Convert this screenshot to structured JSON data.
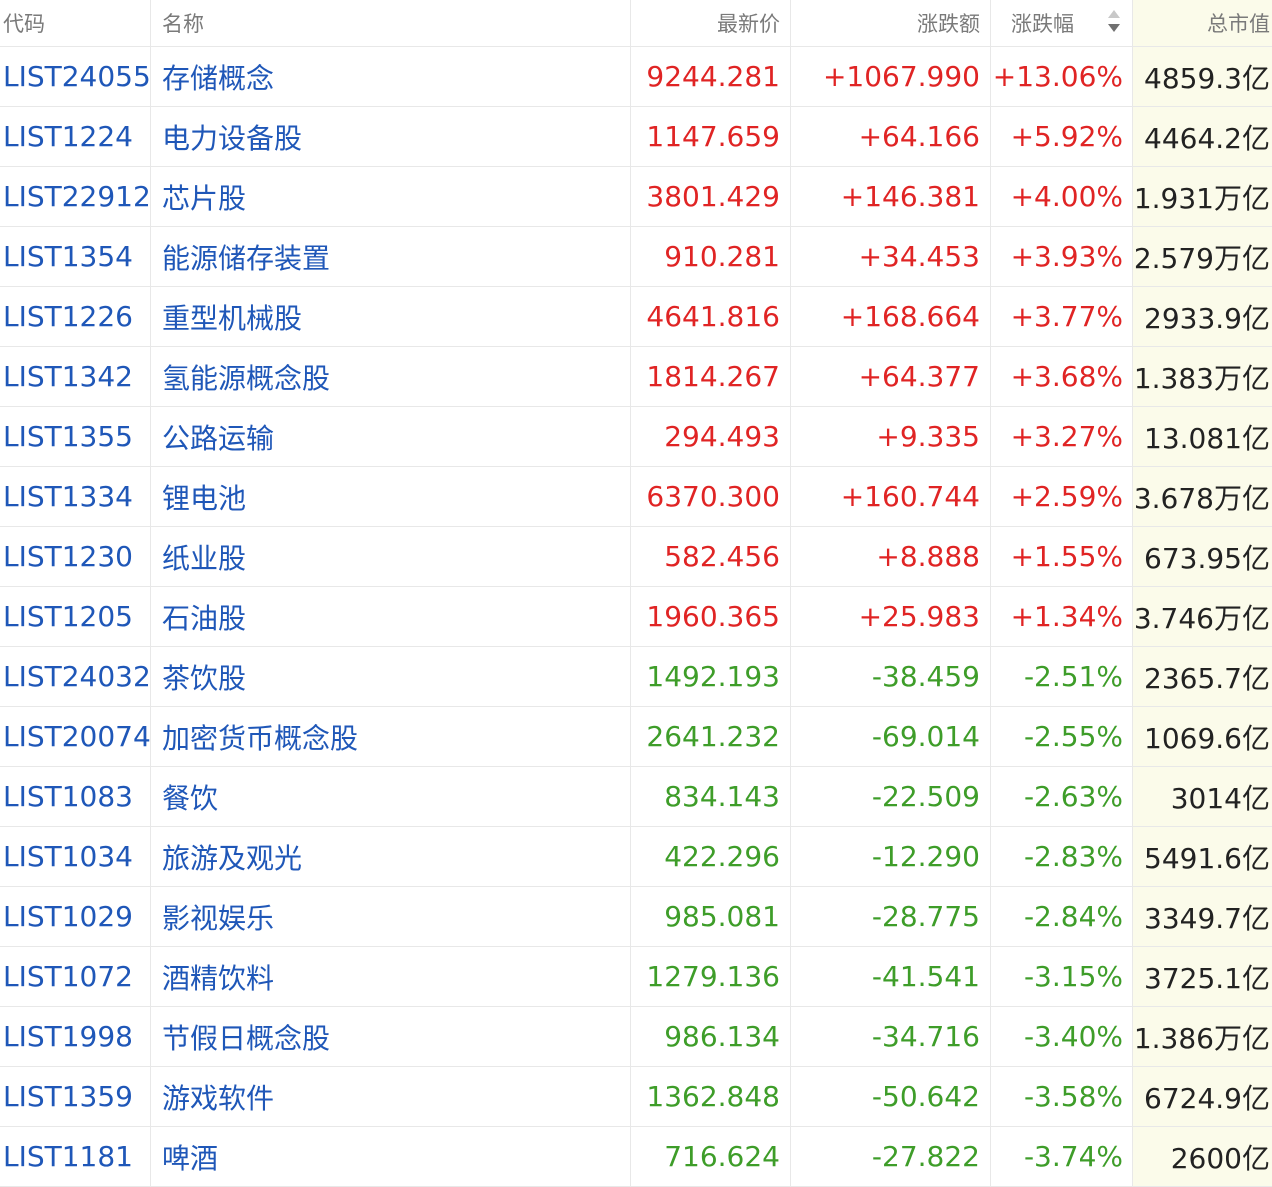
{
  "colors": {
    "link": "#1f57b8",
    "up": "#e02424",
    "down": "#3e9d29",
    "highlight_column": "#fbfbea"
  },
  "header": {
    "code": "代码",
    "name": "名称",
    "price": "最新价",
    "change": "涨跌额",
    "change_pct": "涨跌幅",
    "market_cap": "总市值",
    "sort_icon": "sort-desc-icon"
  },
  "rows": [
    {
      "code": "LIST24055",
      "name": "存储概念",
      "price": "9244.281",
      "change": "+1067.990",
      "change_pct": "+13.06%",
      "market_cap": "4859.3亿",
      "direction": "up"
    },
    {
      "code": "LIST1224",
      "name": "电力设备股",
      "price": "1147.659",
      "change": "+64.166",
      "change_pct": "+5.92%",
      "market_cap": "4464.2亿",
      "direction": "up"
    },
    {
      "code": "LIST22912",
      "name": "芯片股",
      "price": "3801.429",
      "change": "+146.381",
      "change_pct": "+4.00%",
      "market_cap": "1.931万亿",
      "direction": "up"
    },
    {
      "code": "LIST1354",
      "name": "能源储存装置",
      "price": "910.281",
      "change": "+34.453",
      "change_pct": "+3.93%",
      "market_cap": "2.579万亿",
      "direction": "up"
    },
    {
      "code": "LIST1226",
      "name": "重型机械股",
      "price": "4641.816",
      "change": "+168.664",
      "change_pct": "+3.77%",
      "market_cap": "2933.9亿",
      "direction": "up"
    },
    {
      "code": "LIST1342",
      "name": "氢能源概念股",
      "price": "1814.267",
      "change": "+64.377",
      "change_pct": "+3.68%",
      "market_cap": "1.383万亿",
      "direction": "up"
    },
    {
      "code": "LIST1355",
      "name": "公路运输",
      "price": "294.493",
      "change": "+9.335",
      "change_pct": "+3.27%",
      "market_cap": "13.081亿",
      "direction": "up"
    },
    {
      "code": "LIST1334",
      "name": "锂电池",
      "price": "6370.300",
      "change": "+160.744",
      "change_pct": "+2.59%",
      "market_cap": "3.678万亿",
      "direction": "up"
    },
    {
      "code": "LIST1230",
      "name": "纸业股",
      "price": "582.456",
      "change": "+8.888",
      "change_pct": "+1.55%",
      "market_cap": "673.95亿",
      "direction": "up"
    },
    {
      "code": "LIST1205",
      "name": "石油股",
      "price": "1960.365",
      "change": "+25.983",
      "change_pct": "+1.34%",
      "market_cap": "3.746万亿",
      "direction": "up"
    },
    {
      "code": "LIST24032",
      "name": "茶饮股",
      "price": "1492.193",
      "change": "-38.459",
      "change_pct": "-2.51%",
      "market_cap": "2365.7亿",
      "direction": "down"
    },
    {
      "code": "LIST20074",
      "name": "加密货币概念股",
      "price": "2641.232",
      "change": "-69.014",
      "change_pct": "-2.55%",
      "market_cap": "1069.6亿",
      "direction": "down"
    },
    {
      "code": "LIST1083",
      "name": "餐饮",
      "price": "834.143",
      "change": "-22.509",
      "change_pct": "-2.63%",
      "market_cap": "3014亿",
      "direction": "down"
    },
    {
      "code": "LIST1034",
      "name": "旅游及观光",
      "price": "422.296",
      "change": "-12.290",
      "change_pct": "-2.83%",
      "market_cap": "5491.6亿",
      "direction": "down"
    },
    {
      "code": "LIST1029",
      "name": "影视娱乐",
      "price": "985.081",
      "change": "-28.775",
      "change_pct": "-2.84%",
      "market_cap": "3349.7亿",
      "direction": "down"
    },
    {
      "code": "LIST1072",
      "name": "酒精饮料",
      "price": "1279.136",
      "change": "-41.541",
      "change_pct": "-3.15%",
      "market_cap": "3725.1亿",
      "direction": "down"
    },
    {
      "code": "LIST1998",
      "name": "节假日概念股",
      "price": "986.134",
      "change": "-34.716",
      "change_pct": "-3.40%",
      "market_cap": "1.386万亿",
      "direction": "down"
    },
    {
      "code": "LIST1359",
      "name": "游戏软件",
      "price": "1362.848",
      "change": "-50.642",
      "change_pct": "-3.58%",
      "market_cap": "6724.9亿",
      "direction": "down"
    },
    {
      "code": "LIST1181",
      "name": "啤酒",
      "price": "716.624",
      "change": "-27.822",
      "change_pct": "-3.74%",
      "market_cap": "2600亿",
      "direction": "down"
    }
  ]
}
